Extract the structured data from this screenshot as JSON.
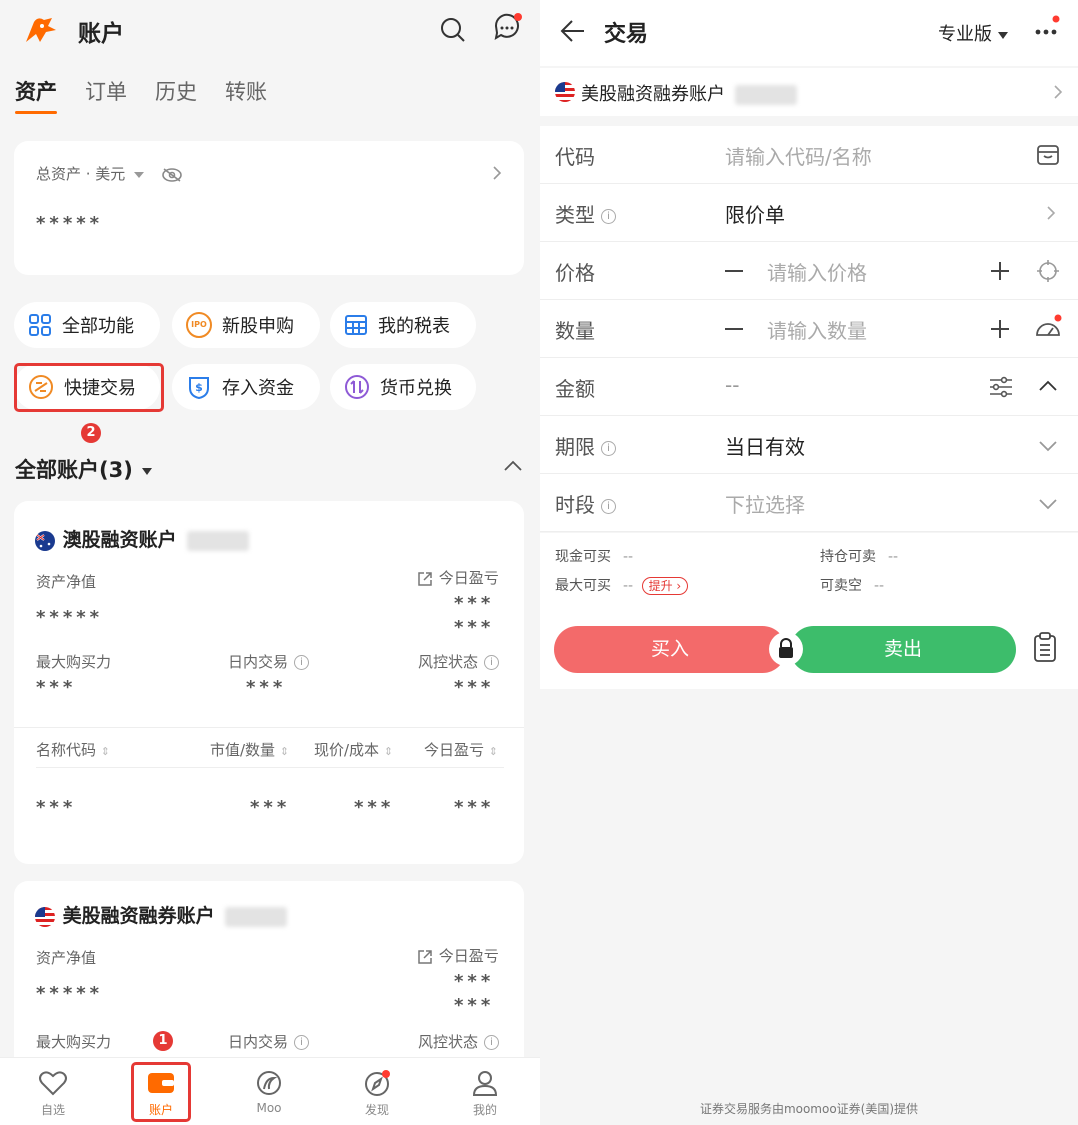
{
  "left": {
    "header": {
      "title": "账户"
    },
    "tabs": [
      "资产",
      "订单",
      "历史",
      "转账"
    ],
    "assets": {
      "label": "总资产 · 美元",
      "value": "*****"
    },
    "quick": {
      "all_functions": "全部功能",
      "ipo": "新股申购",
      "tax": "我的税表",
      "quick_trade": "快捷交易",
      "deposit": "存入资金",
      "currency": "货币兑换",
      "ipo_icon_text": "IPO"
    },
    "badges": {
      "one": "1",
      "two": "2"
    },
    "accounts_header": "全部账户(3)",
    "account_au": {
      "name": "澳股融资账户",
      "net_label": "资产净值",
      "net_value": "*****",
      "pnl_label": "今日盈亏",
      "pnl_value1": "***",
      "pnl_value2": "***",
      "max_buy_label": "最大购买力",
      "max_buy_value": "***",
      "intraday_label": "日内交易",
      "intraday_value": "***",
      "risk_label": "风控状态",
      "risk_value": "***",
      "cols": [
        "名称代码",
        "市值/数量",
        "现价/成本",
        "今日盈亏"
      ],
      "row": [
        "***",
        "***",
        "***",
        "***"
      ]
    },
    "account_us": {
      "name": "美股融资融券账户",
      "net_label": "资产净值",
      "net_value": "*****",
      "pnl_label": "今日盈亏",
      "pnl_value1": "***",
      "pnl_value2": "***",
      "max_buy_label": "最大购买力",
      "intraday_label": "日内交易",
      "risk_label": "风控状态"
    },
    "tabbar": [
      "自选",
      "账户",
      "Moo",
      "发现",
      "我的"
    ]
  },
  "right": {
    "header": {
      "title": "交易",
      "mode": "专业版"
    },
    "account": "美股融资融券账户",
    "form": {
      "code_label": "代码",
      "code_placeholder": "请输入代码/名称",
      "type_label": "类型",
      "type_value": "限价单",
      "price_label": "价格",
      "price_placeholder": "请输入价格",
      "qty_label": "数量",
      "qty_placeholder": "请输入数量",
      "amount_label": "金额",
      "amount_value": "--",
      "term_label": "期限",
      "term_value": "当日有效",
      "session_label": "时段",
      "session_placeholder": "下拉选择"
    },
    "info": {
      "cash_buy": "现金可买",
      "cash_buy_value": "--",
      "max_buy": "最大可买",
      "max_buy_value": "--",
      "boost": "提升",
      "hold_sell": "持仓可卖",
      "hold_sell_value": "--",
      "short": "可卖空",
      "short_value": "--"
    },
    "buttons": {
      "buy": "买入",
      "sell": "卖出"
    },
    "footer": "证券交易服务由moomoo证券(美国)提供"
  },
  "colors": {
    "accent": "#ff6a00",
    "buy": "#f36a6a",
    "sell": "#3dbd6b",
    "highlight": "#e53935"
  }
}
